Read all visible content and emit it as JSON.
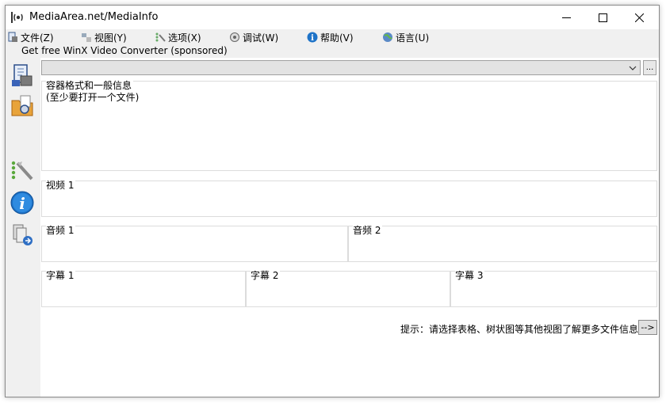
{
  "window": {
    "title": "MediaArea.net/MediaInfo"
  },
  "menu": [
    {
      "label": "文件(Z)",
      "icon": "file-icon"
    },
    {
      "label": "视图(Y)",
      "icon": "view-icon"
    },
    {
      "label": "选项(X)",
      "icon": "options-icon"
    },
    {
      "label": "调试(W)",
      "icon": "debug-icon"
    },
    {
      "label": "帮助(V)",
      "icon": "help-icon"
    },
    {
      "label": "语言(U)",
      "icon": "language-icon"
    }
  ],
  "sponsor": "Get free WinX Video Converter (sponsored)",
  "file_selector": {
    "value": "",
    "browse_label": "..."
  },
  "sections": {
    "general": {
      "title": "容器格式和一般信息",
      "text": "(至少要打开一个文件)"
    },
    "video": [
      "视频 1"
    ],
    "audio": [
      "音频 1",
      "音频 2"
    ],
    "text": [
      "字幕 1",
      "字幕 2",
      "字幕 3"
    ]
  },
  "hint": {
    "text": "提示：请选择表格、树状图等其他视图了解更多文件信息",
    "button": "-->"
  },
  "sidebar_icons": [
    "open-file-icon",
    "open-folder-icon",
    "tree-view-icon",
    "info-icon",
    "export-icon"
  ],
  "colors": {
    "accent": "#1e73c8",
    "title_bg": "#ffffff",
    "chrome_bg": "#f0f0f0"
  }
}
